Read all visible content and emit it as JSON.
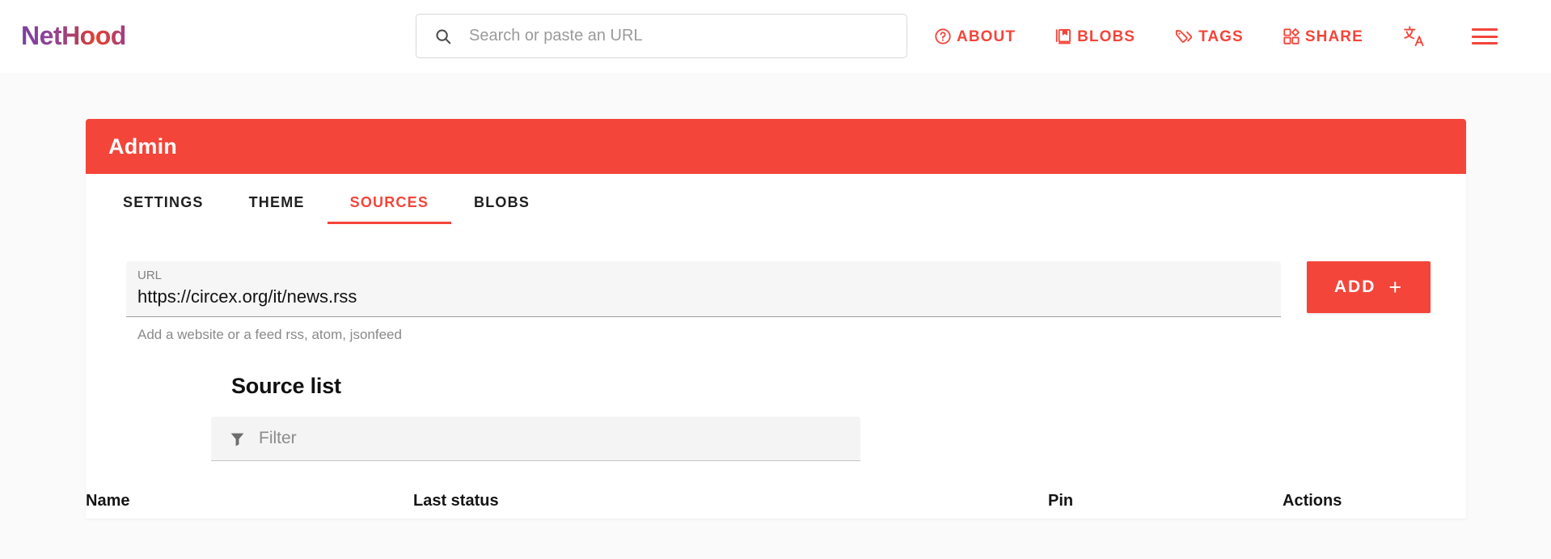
{
  "brand": {
    "name": "NetHood"
  },
  "search": {
    "placeholder": "Search or paste an URL",
    "value": "",
    "icon": "search-icon"
  },
  "nav": {
    "items": [
      {
        "label": "ABOUT",
        "icon": "question-circle-icon"
      },
      {
        "label": "BLOBS",
        "icon": "blobs-book-icon"
      },
      {
        "label": "TAGS",
        "icon": "tags-icon"
      },
      {
        "label": "SHARE",
        "icon": "share-grid-icon"
      }
    ],
    "language_icon": "translate-icon",
    "menu_icon": "hamburger-menu-icon"
  },
  "admin": {
    "title": "Admin",
    "tabs": [
      {
        "label": "SETTINGS",
        "active": false
      },
      {
        "label": "THEME",
        "active": false
      },
      {
        "label": "SOURCES",
        "active": true
      },
      {
        "label": "BLOBS",
        "active": false
      }
    ]
  },
  "source_form": {
    "url_label": "URL",
    "url_value": "https://circex.org/it/news.rss",
    "url_placeholder": "",
    "hint": "Add a website or a feed rss, atom, jsonfeed",
    "add_label": "ADD",
    "add_plus": "+"
  },
  "source_list": {
    "heading": "Source list",
    "filter_placeholder": "Filter",
    "filter_value": "",
    "filter_icon": "funnel-icon",
    "columns": [
      "Name",
      "Last status",
      "Pin",
      "Actions"
    ],
    "rows": []
  },
  "colors": {
    "accent_red": "#f4453a",
    "page_bg": "#fafafa",
    "brand_purple": "#7b3f9d",
    "brand_red": "#e8412f",
    "text_dark": "#151515",
    "text_muted": "#8a8a8a"
  }
}
